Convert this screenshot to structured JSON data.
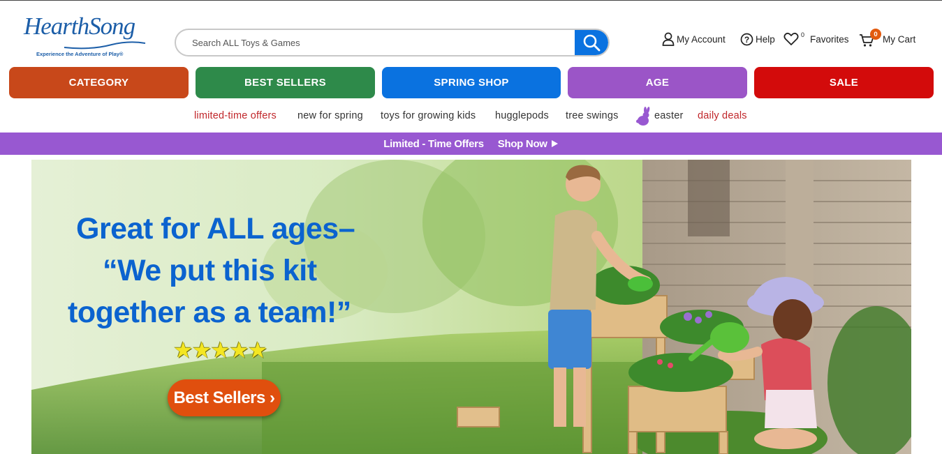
{
  "brand": {
    "name": "HearthSong",
    "tagline": "Experience the Adventure of Play®"
  },
  "search": {
    "placeholder": "Search ALL Toys & Games",
    "value": ""
  },
  "header_links": {
    "account": "My Account",
    "help": "Help",
    "favorites": "Favorites",
    "favorites_count": "0",
    "cart": "My Cart",
    "cart_count": "0"
  },
  "categories": [
    {
      "label": "CATEGORY",
      "color": "#c8481a"
    },
    {
      "label": "BEST SELLERS",
      "color": "#2e8a4a"
    },
    {
      "label": "SPRING SHOP",
      "color": "#0a72e0"
    },
    {
      "label": "AGE",
      "color": "#9b55c7"
    },
    {
      "label": "SALE",
      "color": "#d30b0b"
    }
  ],
  "quick_links": [
    {
      "label": "limited-time offers",
      "color": "#c0262a"
    },
    {
      "label": "new for spring",
      "color": "#333333"
    },
    {
      "label": "toys for growing kids",
      "color": "#333333"
    },
    {
      "label": "hugglepods",
      "color": "#333333"
    },
    {
      "label": "tree swings",
      "color": "#333333"
    },
    {
      "label": "easter",
      "color": "#333333",
      "icon": "bunny-icon"
    },
    {
      "label": "daily deals",
      "color": "#c0262a"
    }
  ],
  "promo_bar": {
    "text": "Limited - Time Offers",
    "link": "Shop Now",
    "background": "#9858d1"
  },
  "hero": {
    "headline_lines": [
      "Great for ALL ages–",
      "“We put this kit",
      "together as a team!”"
    ],
    "rating_stars": 5,
    "rating_display": "★★★★★",
    "cta_label": "Best Sellers ›"
  }
}
